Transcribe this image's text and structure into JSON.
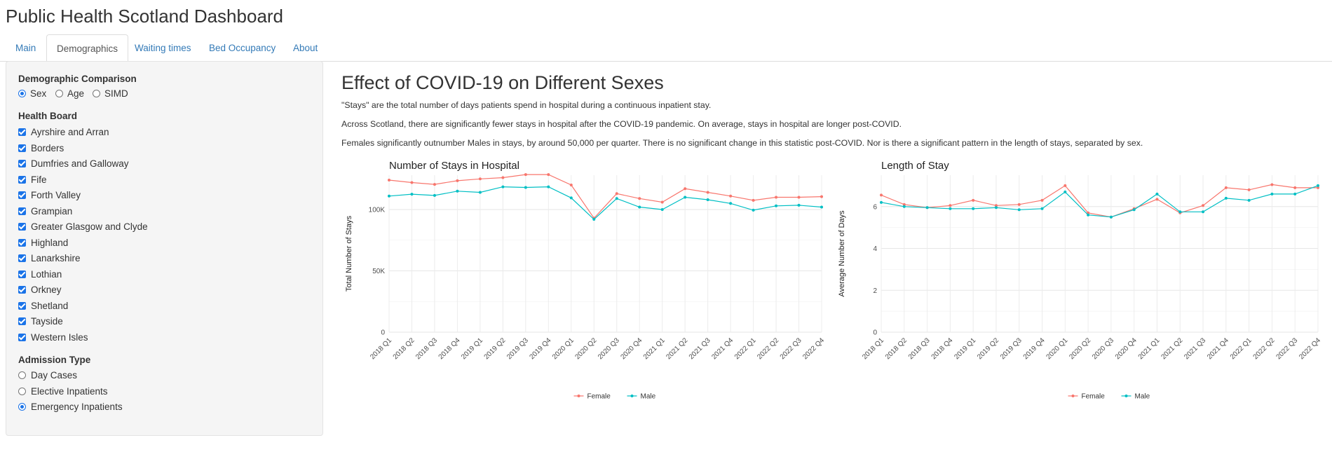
{
  "app": {
    "title": "Public Health Scotland Dashboard"
  },
  "tabs": [
    {
      "label": "Main",
      "active": false
    },
    {
      "label": "Demographics",
      "active": true
    },
    {
      "label": "Waiting times",
      "active": false
    },
    {
      "label": "Bed Occupancy",
      "active": false
    },
    {
      "label": "About",
      "active": false
    }
  ],
  "sidebar": {
    "comparison": {
      "label": "Demographic Comparison",
      "options": [
        {
          "label": "Sex",
          "selected": true
        },
        {
          "label": "Age",
          "selected": false
        },
        {
          "label": "SIMD",
          "selected": false
        }
      ]
    },
    "health_board": {
      "label": "Health Board",
      "items": [
        {
          "label": "Ayrshire and Arran",
          "checked": true
        },
        {
          "label": "Borders",
          "checked": true
        },
        {
          "label": "Dumfries and Galloway",
          "checked": true
        },
        {
          "label": "Fife",
          "checked": true
        },
        {
          "label": "Forth Valley",
          "checked": true
        },
        {
          "label": "Grampian",
          "checked": true
        },
        {
          "label": "Greater Glasgow and Clyde",
          "checked": true
        },
        {
          "label": "Highland",
          "checked": true
        },
        {
          "label": "Lanarkshire",
          "checked": true
        },
        {
          "label": "Lothian",
          "checked": true
        },
        {
          "label": "Orkney",
          "checked": true
        },
        {
          "label": "Shetland",
          "checked": true
        },
        {
          "label": "Tayside",
          "checked": true
        },
        {
          "label": "Western Isles",
          "checked": true
        }
      ]
    },
    "admission_type": {
      "label": "Admission Type",
      "options": [
        {
          "label": "Day Cases",
          "selected": false
        },
        {
          "label": "Elective Inpatients",
          "selected": false
        },
        {
          "label": "Emergency Inpatients",
          "selected": true
        }
      ]
    }
  },
  "main": {
    "title": "Effect of COVID-19 on Different Sexes",
    "paragraphs": [
      "\"Stays\" are the total number of days patients spend in hospital during a continuous inpatient stay.",
      "Across Scotland, there are significantly fewer stays in hospital after the COVID-19 pandemic. On average, stays in hospital are longer post-COVID.",
      "Females significantly outnumber Males in stays, by around 50,000 per quarter. There is no significant change in this statistic post-COVID. Nor is there a significant pattern in the length of stays, separated by sex."
    ]
  },
  "colors": {
    "female": "#F8766D",
    "male": "#00BFC4",
    "accent": "#1a73e8",
    "link": "#337ab7"
  },
  "chart_data": [
    {
      "type": "line",
      "title": "Number of Stays in Hospital",
      "xlabel": "",
      "ylabel": "Total Number of Stays",
      "categories": [
        "2018 Q1",
        "2018 Q2",
        "2018 Q3",
        "2018 Q4",
        "2019 Q1",
        "2019 Q2",
        "2019 Q3",
        "2019 Q4",
        "2020 Q1",
        "2020 Q2",
        "2020 Q3",
        "2020 Q4",
        "2021 Q1",
        "2021 Q2",
        "2021 Q3",
        "2021 Q4",
        "2022 Q1",
        "2022 Q2",
        "2022 Q3",
        "2022 Q4"
      ],
      "ylim": [
        0,
        128000
      ],
      "yticks": [
        0,
        50000,
        100000
      ],
      "yticklabels": [
        "0",
        "50K",
        "100K"
      ],
      "series": [
        {
          "name": "Female",
          "color": "#F8766D",
          "values": [
            124000,
            122000,
            120500,
            123500,
            125000,
            126000,
            128500,
            128500,
            120000,
            93000,
            113000,
            109000,
            106000,
            117000,
            114000,
            111000,
            107500,
            110000,
            110000,
            110500
          ]
        },
        {
          "name": "Male",
          "color": "#00BFC4",
          "values": [
            111000,
            112500,
            111500,
            115000,
            114000,
            118500,
            118000,
            118500,
            109500,
            92000,
            109000,
            102000,
            100000,
            110000,
            108000,
            105000,
            99500,
            103000,
            103500,
            102000
          ]
        }
      ],
      "grid": true,
      "legend": "bottom"
    },
    {
      "type": "line",
      "title": "Length of Stay",
      "xlabel": "",
      "ylabel": "Average Number of Days",
      "categories": [
        "2018 Q1",
        "2018 Q2",
        "2018 Q3",
        "2018 Q4",
        "2019 Q1",
        "2019 Q2",
        "2019 Q3",
        "2019 Q4",
        "2020 Q1",
        "2020 Q2",
        "2020 Q3",
        "2020 Q4",
        "2021 Q1",
        "2021 Q2",
        "2021 Q3",
        "2021 Q4",
        "2022 Q1",
        "2022 Q2",
        "2022 Q3",
        "2022 Q4"
      ],
      "ylim": [
        0,
        7.5
      ],
      "yticks": [
        0,
        2,
        4,
        6
      ],
      "yticklabels": [
        "0",
        "2",
        "4",
        "6"
      ],
      "series": [
        {
          "name": "Female",
          "color": "#F8766D",
          "values": [
            6.55,
            6.1,
            5.95,
            6.05,
            6.3,
            6.05,
            6.1,
            6.3,
            7.0,
            5.7,
            5.5,
            5.9,
            6.35,
            5.7,
            6.05,
            6.9,
            6.8,
            7.05,
            6.9,
            6.9
          ]
        },
        {
          "name": "Male",
          "color": "#00BFC4",
          "values": [
            6.2,
            6.0,
            5.95,
            5.9,
            5.9,
            5.95,
            5.85,
            5.9,
            6.7,
            5.6,
            5.5,
            5.85,
            6.6,
            5.75,
            5.75,
            6.4,
            6.3,
            6.6,
            6.6,
            7.0
          ]
        }
      ],
      "grid": true,
      "legend": "bottom"
    }
  ]
}
